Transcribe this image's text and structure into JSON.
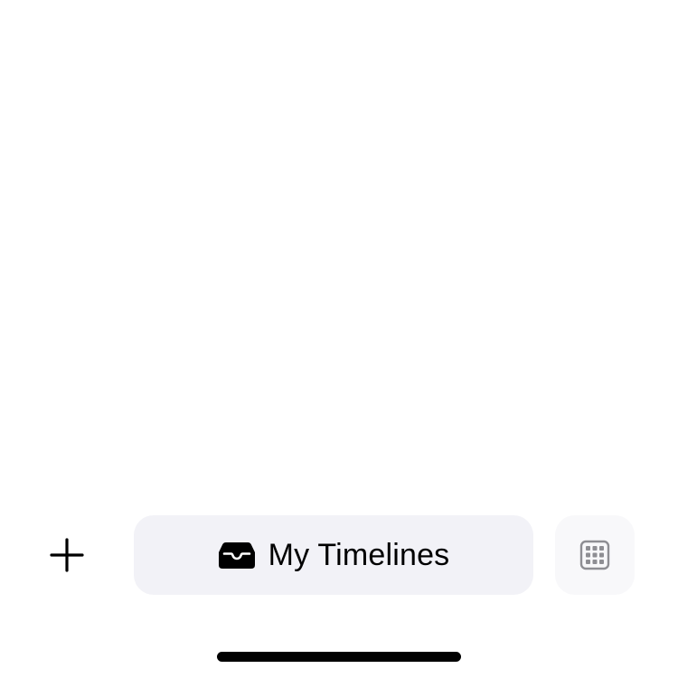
{
  "toolbar": {
    "add_icon": "plus-icon",
    "timelines_button": {
      "icon": "tray-icon",
      "label": "My Timelines",
      "background": "#f2f2f7"
    },
    "grid_icon": "calendar-grid-icon"
  },
  "colors": {
    "background": "#ffffff",
    "text": "#000000",
    "icon_muted": "#8e8e93"
  }
}
